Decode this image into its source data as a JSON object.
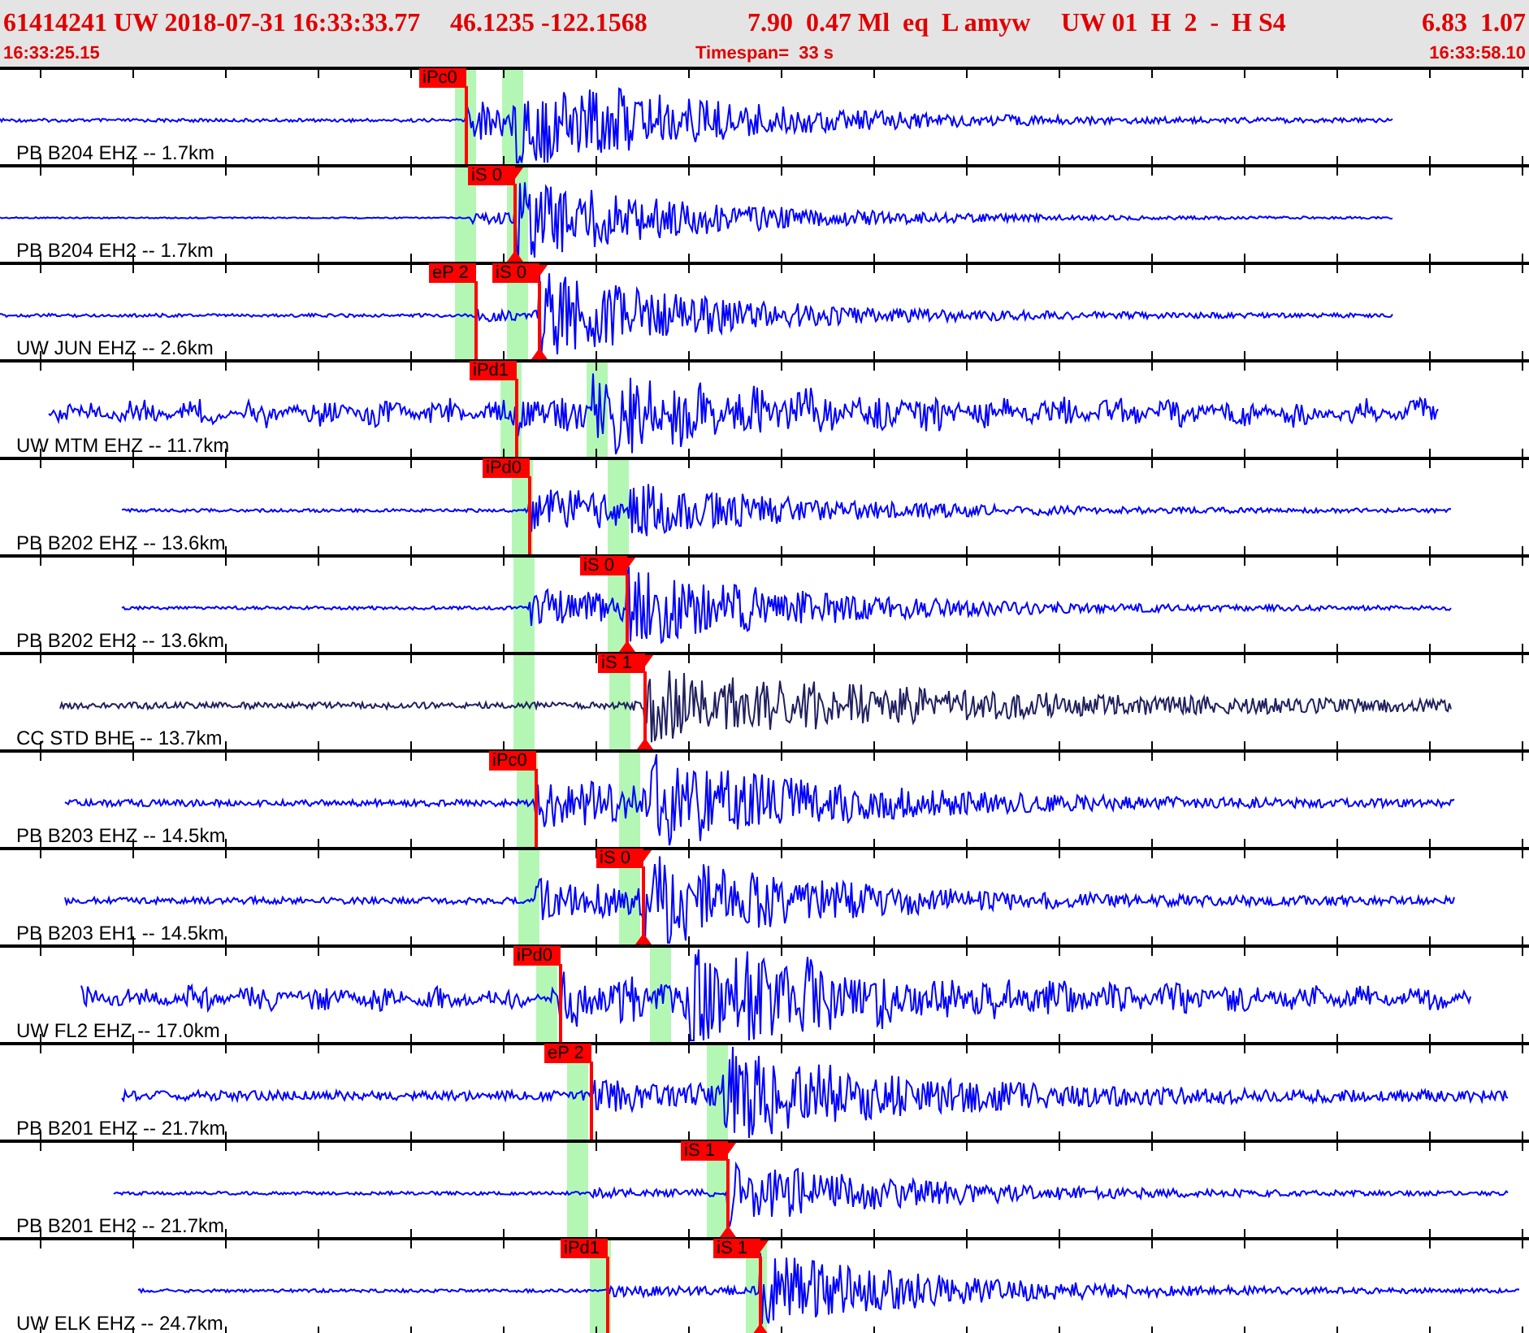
{
  "header": {
    "fields": [
      "61414241 UW 2018-07-31 16:33:33.77",
      "46.1235 -122.1568",
      "7.90  0.47 Ml  eq  L amyw",
      "UW 01  H  2  -  H S4",
      "6.83  1.07"
    ],
    "start_time": "16:33:25.15",
    "timespan": "Timespan=  33 s",
    "end_time": "16:33:58.10"
  },
  "traces": [
    {
      "label": "PB B204 EHZ -- 1.7km",
      "color": "#0000ff",
      "picks": [
        {
          "label": "iPc0",
          "kind": "p"
        }
      ]
    },
    {
      "label": "PB B204 EH2 -- 1.7km",
      "color": "#0000ff",
      "picks": [
        {
          "label": "iS 0",
          "kind": "s"
        }
      ]
    },
    {
      "label": "UW JUN EHZ -- 2.6km",
      "color": "#0000ff",
      "picks": [
        {
          "label": "eP 2",
          "kind": "p"
        },
        {
          "label": "iS 0",
          "kind": "s"
        }
      ]
    },
    {
      "label": "UW MTM EHZ -- 11.7km",
      "color": "#0000ff",
      "picks": [
        {
          "label": "iPd1",
          "kind": "p"
        }
      ]
    },
    {
      "label": "PB B202 EHZ -- 13.6km",
      "color": "#0000ff",
      "picks": [
        {
          "label": "iPd0",
          "kind": "p"
        }
      ]
    },
    {
      "label": "PB B202 EH2 -- 13.6km",
      "color": "#0000ff",
      "picks": [
        {
          "label": "iS 0",
          "kind": "s"
        }
      ]
    },
    {
      "label": "CC STD BHE -- 13.7km",
      "color": "#202060",
      "picks": [
        {
          "label": "iS 1",
          "kind": "s"
        }
      ]
    },
    {
      "label": "PB B203 EHZ -- 14.5km",
      "color": "#0000ff",
      "picks": [
        {
          "label": "iPc0",
          "kind": "p"
        }
      ]
    },
    {
      "label": "PB B203 EH1 -- 14.5km",
      "color": "#0000ff",
      "picks": [
        {
          "label": "iS 0",
          "kind": "s"
        }
      ]
    },
    {
      "label": "UW FL2 EHZ -- 17.0km",
      "color": "#0000ff",
      "picks": [
        {
          "label": "iPd0",
          "kind": "p"
        }
      ]
    },
    {
      "label": "PB B201 EHZ -- 21.7km",
      "color": "#0000ff",
      "picks": [
        {
          "label": "eP 2",
          "kind": "p"
        }
      ]
    },
    {
      "label": "PB B201 EH2 -- 21.7km",
      "color": "#0000ff",
      "picks": [
        {
          "label": "iS 1",
          "kind": "s"
        }
      ]
    },
    {
      "label": "UW ELK EHZ -- 24.7km",
      "color": "#0000ff",
      "picks": [
        {
          "label": "iPd1",
          "kind": "p"
        },
        {
          "label": "iS 1",
          "kind": "s"
        }
      ]
    }
  ]
}
